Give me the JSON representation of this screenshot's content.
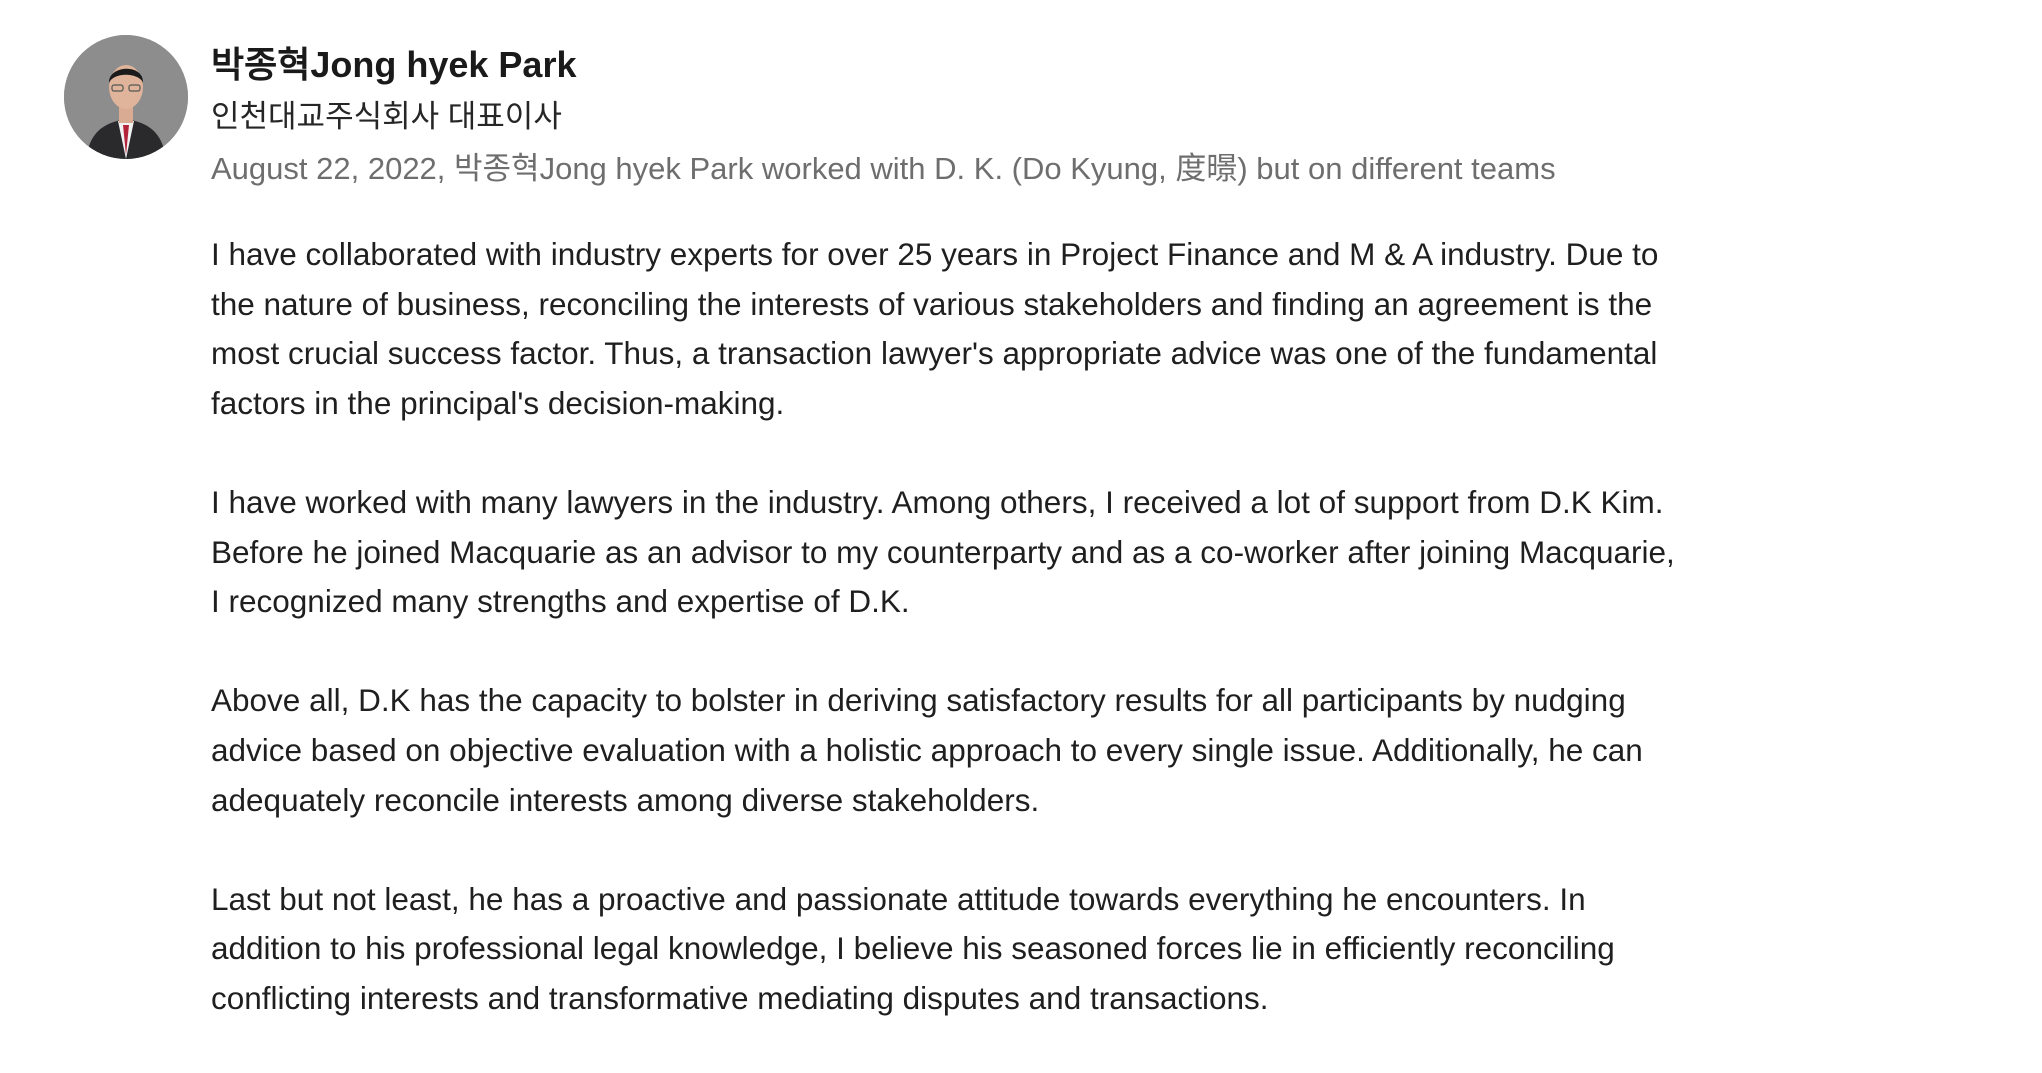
{
  "recommendation": {
    "author": {
      "name": "박종혁Jong hyek Park",
      "headline": "인천대교주식회사 대표이사",
      "avatar_icon": "profile-photo"
    },
    "meta": "August 22, 2022, 박종혁Jong hyek Park worked with D. K. (Do Kyung, 度暻) but on different teams",
    "paragraphs": [
      [
        "I have collaborated with industry experts for over 25 years in Project Finance and M & A industry. Due to",
        "the nature of business, reconciling the interests of various stakeholders and finding an agreement is the",
        "most crucial success factor. Thus, a transaction lawyer's appropriate advice was one of the fundamental",
        "factors in the principal's decision-making."
      ],
      [
        "I have worked with many lawyers in the industry. Among others, I received a lot of support from D.K Kim.",
        "Before he joined Macquarie as an advisor to my counterparty and as a co-worker after joining Macquarie,",
        "I recognized many strengths and expertise of D.K."
      ],
      [
        "Above all, D.K has the capacity to bolster in deriving satisfactory results for all participants by nudging",
        "advice based on objective evaluation with a holistic approach to every single issue. Additionally, he can",
        "adequately reconcile interests among diverse stakeholders."
      ],
      [
        "Last but not least, he has a proactive and passionate attitude towards everything he encounters. In",
        "addition to his professional legal knowledge, I believe his seasoned forces lie in efficiently reconciling",
        "conflicting interests and transformative mediating disputes and transactions."
      ]
    ]
  }
}
